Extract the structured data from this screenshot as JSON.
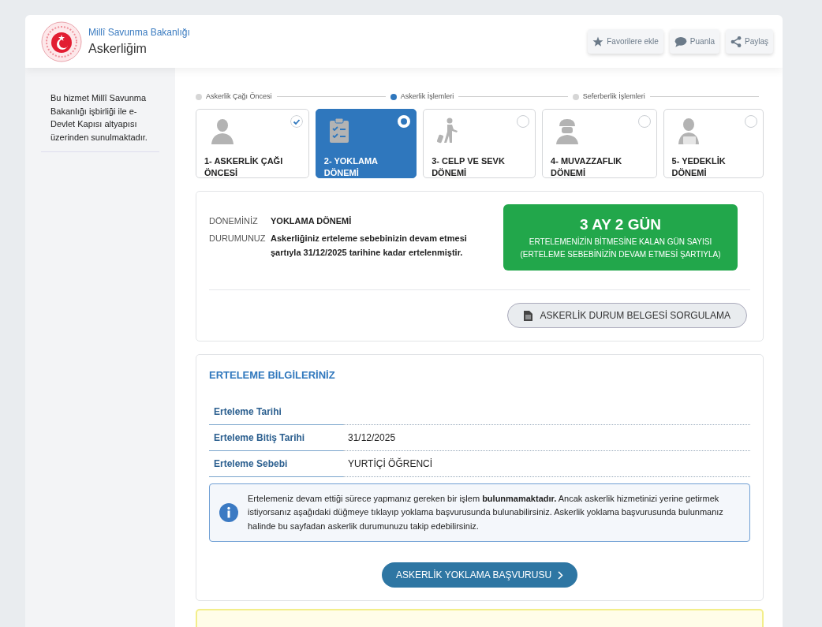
{
  "header": {
    "ministry": "Millî Savunma Bakanlığı",
    "title": "Askerliğim",
    "actions": [
      "Favorilere ekle",
      "Puanla",
      "Paylaş"
    ]
  },
  "sidebar": {
    "text": "Bu hizmet Millî Savunma Bakanlığı işbirliği ile e-Devlet Kapısı altyapısı üzerinden sunulmaktadır."
  },
  "phases": [
    {
      "label": "Askerlik Çağı Öncesi",
      "selected": false
    },
    {
      "label": "Askerlik İşlemleri",
      "selected": true
    },
    {
      "label": "Seferberlik İşlemleri",
      "selected": false
    }
  ],
  "steps": [
    {
      "label": "1- ASKERLİK ÇAĞI ÖNCESİ",
      "selected": false,
      "done": true
    },
    {
      "label": "2- YOKLAMA DÖNEMİ",
      "selected": true,
      "done": false
    },
    {
      "label": "3- CELP VE SEVK DÖNEMİ",
      "selected": false,
      "done": false
    },
    {
      "label": "4- MUVAZZAFLIK DÖNEMİ",
      "selected": false,
      "done": false
    },
    {
      "label": "5- YEDEKLİK DÖNEMİ",
      "selected": false,
      "done": false
    }
  ],
  "status": {
    "period_label": "DÖNEMİNİZ",
    "period": "YOKLAMA DÖNEMİ",
    "state_label": "DURUMUNUZ",
    "state": "Askerliğiniz erteleme sebebinizin devam etmesi şartıyla 31/12/2025 tarihine kadar ertelenmiştir.",
    "remaining": "3 AY 2 GÜN",
    "remaining_caption": "ERTELEMENİZİN BİTMESİNE KALAN GÜN SAYISI (ERTELEME SEBEBİNİZİN DEVAM ETMESİ ŞARTIYLA)",
    "document_button": "ASKERLİK DURUM BELGESİ SORGULAMA"
  },
  "deferral": {
    "title": "ERTELEME BİLGİLERİNİZ",
    "rows": [
      {
        "label": "Erteleme Tarihi"
      },
      {
        "label": "Erteleme Bitiş Tarihi",
        "value": "31/12/2025"
      },
      {
        "label": "Erteleme Sebebi",
        "value": "YURTİÇİ ÖĞRENCİ"
      }
    ],
    "info": "Ertelemeniz devam ettiği sürece yapmanız gereken bir işlem **bulunmamaktadır.** Ancak askerlik hizmetinizi yerine getirmek istiyorsanız aşağıdaki düğmeye tıklayıp yoklama başvurusunda bulunabilirsiniz. Askerlik yoklama başvurusunda bulunmanız halinde bu sayfadan askerlik durumunuzu takip edebilirsiniz.",
    "apply_button": "ASKERLİK YOKLAMA BAŞVURUSU"
  }
}
